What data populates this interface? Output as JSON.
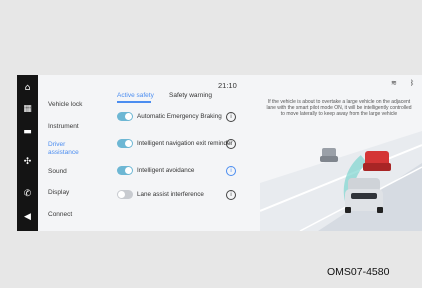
{
  "menu": {
    "items": [
      {
        "label": "Vehicle lock"
      },
      {
        "label": "Instrument"
      },
      {
        "label": "Driver assistance"
      },
      {
        "label": "Sound"
      },
      {
        "label": "Display"
      },
      {
        "label": "Connect"
      }
    ],
    "active_index": 2
  },
  "status": {
    "time": "21:10",
    "wifi_icon": "wifi-icon",
    "bluetooth_icon": "bluetooth-icon"
  },
  "tabs": [
    {
      "label": "Active safety",
      "active": true
    },
    {
      "label": "Safety warning",
      "active": false
    }
  ],
  "settings": [
    {
      "label": "Automatic Emergency Braking",
      "enabled": true
    },
    {
      "label": "Intelligent navigation exit reminder",
      "enabled": true
    },
    {
      "label": "Intelligent avoidance",
      "enabled": true
    },
    {
      "label": "Lane assist interference",
      "enabled": false
    }
  ],
  "description": "If the vehicle is about to overtake a large vehicle on the adjacent lane with the smart pilot mode ON, it will be intelligently controlled to move laterally to keep away from the large vehicle",
  "figure_id": "OMS07-4580",
  "colors": {
    "accent": "#4b8df0",
    "toggle_on": "#6db7d4",
    "toggle_off": "#c8cbd0",
    "iconbar": "#141414"
  }
}
